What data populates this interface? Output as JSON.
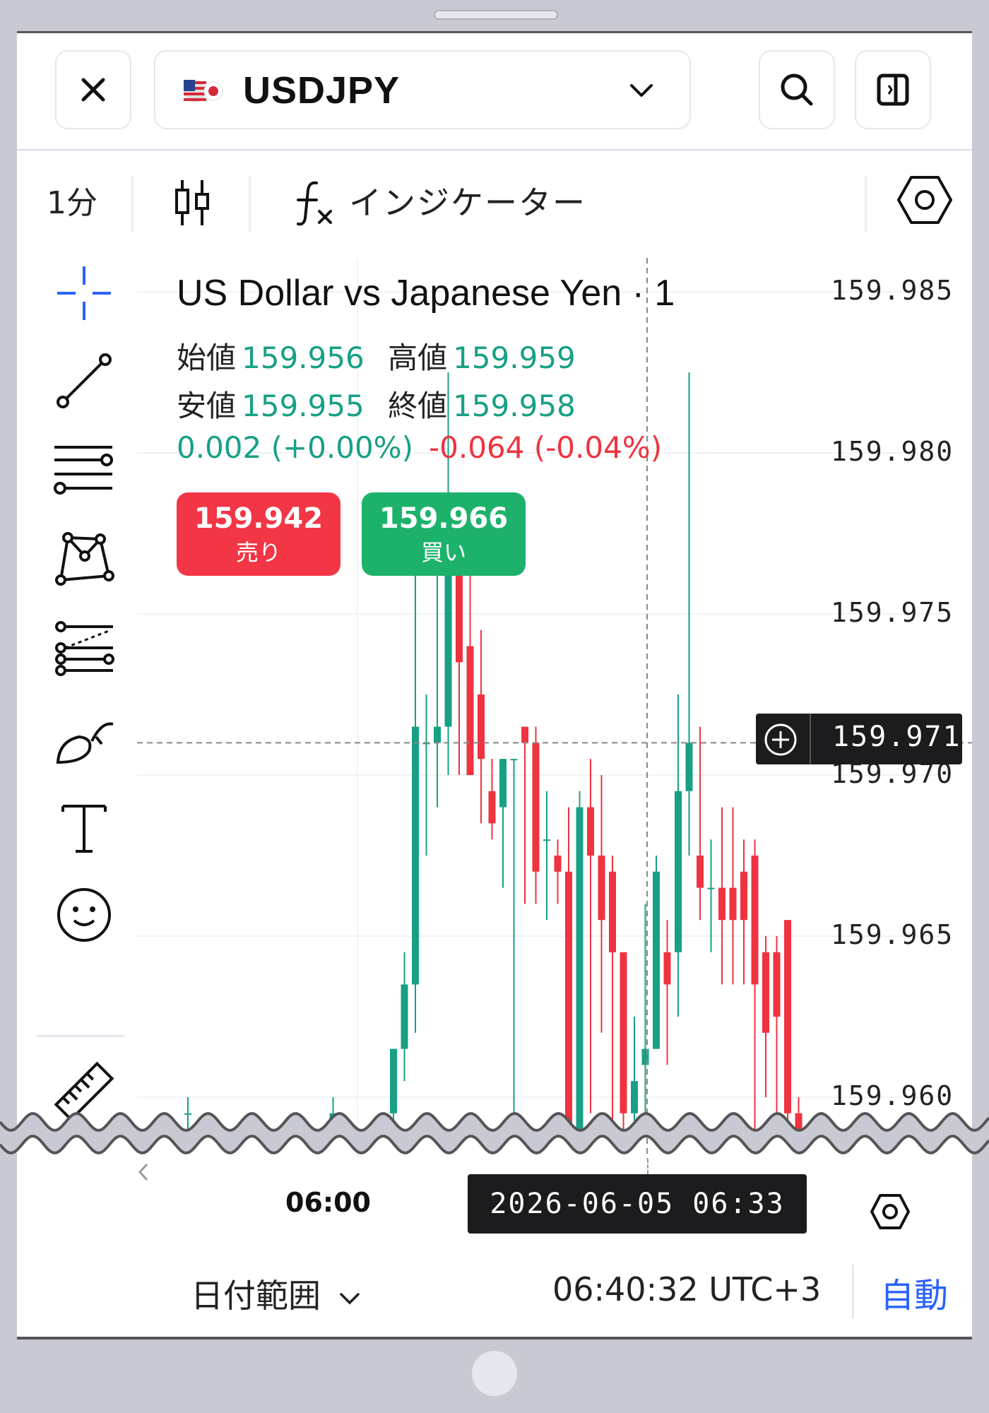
{
  "header": {
    "symbol": "USDJPY",
    "close_icon": "close-icon",
    "flag_icon": "us-jp-flag-icon",
    "dropdown_icon": "chevron-down-icon",
    "search_icon": "search-icon",
    "panel_icon": "panel-toggle-icon"
  },
  "toolbar": {
    "timeframe": "1分",
    "indicators_label": "インジケーター",
    "candle_icon": "candlestick-icon",
    "fx_icon": "function-icon",
    "settings_icon": "hexagon-settings-icon"
  },
  "drawing_tools": [
    "crosshair-icon",
    "trend-line-icon",
    "horizontal-lines-icon",
    "pattern-icon",
    "fib-icon",
    "brush-icon",
    "text-icon",
    "emoji-icon",
    "ruler-icon"
  ],
  "legend": {
    "title": "US Dollar vs Japanese Yen · 1",
    "open_label": "始値",
    "open": "159.956",
    "high_label": "高値",
    "high": "159.959",
    "low_label": "安値",
    "low": "159.955",
    "close_label": "終値",
    "close": "159.958",
    "change_1": "0.002 (+0.00%)",
    "change_2": "-0.064 (-0.04%)"
  },
  "trade": {
    "sell_price": "159.942",
    "sell_label": "売り",
    "buy_price": "159.966",
    "buy_label": "買い"
  },
  "crosshair": {
    "price": "159.971",
    "time": "2026-06-05   06:33"
  },
  "axis": {
    "time_label": "06:00"
  },
  "footer": {
    "date_range": "日付範囲",
    "clock": "06:40:32 UTC+3",
    "auto": "自動"
  },
  "colors": {
    "up": "#17a085",
    "down": "#ef3340",
    "accent": "#2962ff"
  },
  "chart_data": {
    "type": "candlestick",
    "y_ticks": [
      159.985,
      159.98,
      159.975,
      159.97,
      159.965,
      159.96
    ],
    "ylim": [
      159.9585,
      159.9865
    ],
    "candles": [
      {
        "o": 159.9595,
        "h": 159.96,
        "l": 159.958,
        "c": 159.9595
      },
      {
        "o": 159.959,
        "h": 159.96,
        "l": 159.958,
        "c": 159.9595
      },
      {
        "o": 159.9595,
        "h": 159.961,
        "l": 159.958,
        "c": 159.9615
      },
      {
        "o": 159.9615,
        "h": 159.9645,
        "l": 159.9605,
        "c": 159.9635
      },
      {
        "o": 159.9635,
        "h": 159.977,
        "l": 159.962,
        "c": 159.9715
      },
      {
        "o": 159.971,
        "h": 159.9725,
        "l": 159.9675,
        "c": 159.971
      },
      {
        "o": 159.971,
        "h": 159.977,
        "l": 159.969,
        "c": 159.9715
      },
      {
        "o": 159.9715,
        "h": 159.9825,
        "l": 159.97,
        "c": 159.9765
      },
      {
        "o": 159.9765,
        "h": 159.9775,
        "l": 159.97,
        "c": 159.9735
      },
      {
        "o": 159.974,
        "h": 159.9765,
        "l": 159.97,
        "c": 159.97
      },
      {
        "o": 159.9725,
        "h": 159.9745,
        "l": 159.9685,
        "c": 159.9705
      },
      {
        "o": 159.9695,
        "h": 159.9705,
        "l": 159.968,
        "c": 159.9685
      },
      {
        "o": 159.969,
        "h": 159.9705,
        "l": 159.9665,
        "c": 159.9705
      },
      {
        "o": 159.9705,
        "h": 159.9705,
        "l": 159.9595,
        "c": 159.9705
      },
      {
        "o": 159.9715,
        "h": 159.9715,
        "l": 159.966,
        "c": 159.971
      },
      {
        "o": 159.971,
        "h": 159.9715,
        "l": 159.966,
        "c": 159.967
      },
      {
        "o": 159.968,
        "h": 159.9695,
        "l": 159.9655,
        "c": 159.968
      },
      {
        "o": 159.9675,
        "h": 159.968,
        "l": 159.966,
        "c": 159.967
      },
      {
        "o": 159.967,
        "h": 159.969,
        "l": 159.9585,
        "c": 159.9585
      },
      {
        "o": 159.9585,
        "h": 159.9695,
        "l": 159.9585,
        "c": 159.969
      },
      {
        "o": 159.969,
        "h": 159.9705,
        "l": 159.9595,
        "c": 159.9675
      },
      {
        "o": 159.9675,
        "h": 159.97,
        "l": 159.962,
        "c": 159.9655
      },
      {
        "o": 159.967,
        "h": 159.9675,
        "l": 159.9585,
        "c": 159.9645
      },
      {
        "o": 159.9645,
        "h": 159.9645,
        "l": 159.9585,
        "c": 159.9595
      },
      {
        "o": 159.9595,
        "h": 159.9625,
        "l": 159.9585,
        "c": 159.9605
      },
      {
        "o": 159.961,
        "h": 159.966,
        "l": 159.9585,
        "c": 159.9615
      },
      {
        "o": 159.9615,
        "h": 159.9675,
        "l": 159.9615,
        "c": 159.967
      },
      {
        "o": 159.9645,
        "h": 159.9655,
        "l": 159.961,
        "c": 159.9635
      },
      {
        "o": 159.9645,
        "h": 159.9725,
        "l": 159.9625,
        "c": 159.9695
      },
      {
        "o": 159.9695,
        "h": 159.9825,
        "l": 159.9675,
        "c": 159.971
      },
      {
        "o": 159.9675,
        "h": 159.9715,
        "l": 159.9655,
        "c": 159.9665
      },
      {
        "o": 159.9665,
        "h": 159.968,
        "l": 159.9645,
        "c": 159.9665
      },
      {
        "o": 159.9665,
        "h": 159.969,
        "l": 159.9635,
        "c": 159.9655
      },
      {
        "o": 159.9665,
        "h": 159.969,
        "l": 159.9635,
        "c": 159.9655
      },
      {
        "o": 159.967,
        "h": 159.968,
        "l": 159.9635,
        "c": 159.9655
      },
      {
        "o": 159.9675,
        "h": 159.968,
        "l": 159.9585,
        "c": 159.9635
      },
      {
        "o": 159.9645,
        "h": 159.965,
        "l": 159.96,
        "c": 159.962
      },
      {
        "o": 159.9645,
        "h": 159.965,
        "l": 159.9595,
        "c": 159.9625
      },
      {
        "o": 159.9655,
        "h": 159.9655,
        "l": 159.9585,
        "c": 159.9595
      },
      {
        "o": 159.9595,
        "h": 159.96,
        "l": 159.9585,
        "c": 159.959
      }
    ]
  }
}
